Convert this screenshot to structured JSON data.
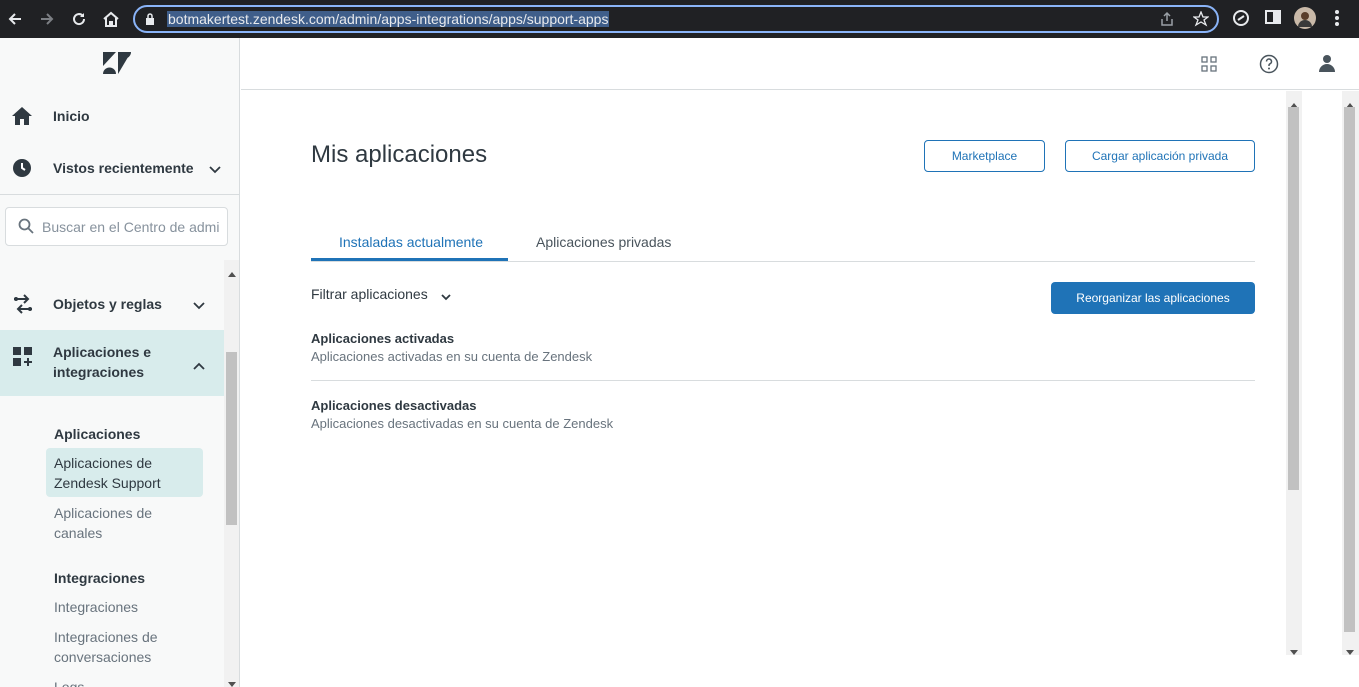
{
  "browser": {
    "url": "botmakertest.zendesk.com/admin/apps-integrations/apps/support-apps"
  },
  "sidebar": {
    "home": "Inicio",
    "recent": "Vistos recientemente",
    "search_placeholder": "Buscar en el Centro de admi",
    "objects": "Objetos y reglas",
    "apps_line1": "Aplicaciones e",
    "apps_line2": "integraciones",
    "apps_heading": "Aplicaciones",
    "support_apps_line1": "Aplicaciones de",
    "support_apps_line2": "Zendesk Support",
    "channel_apps_line1": "Aplicaciones de",
    "channel_apps_line2": "canales",
    "integrations_heading": "Integraciones",
    "integrations": "Integraciones",
    "conv_line1": "Integraciones de",
    "conv_line2": "conversaciones",
    "logs": "Logs"
  },
  "main": {
    "title": "Mis aplicaciones",
    "marketplace_btn": "Marketplace",
    "upload_btn": "Cargar aplicación privada",
    "tabs": [
      {
        "label": "Instaladas actualmente"
      },
      {
        "label": "Aplicaciones privadas"
      }
    ],
    "filter": "Filtrar aplicaciones",
    "reorder_btn": "Reorganizar las aplicaciones",
    "active_title": "Aplicaciones activadas",
    "active_desc": "Aplicaciones activadas en su cuenta de Zendesk",
    "inactive_title": "Aplicaciones desactivadas",
    "inactive_desc": "Aplicaciones desactivadas en su cuenta de Zendesk"
  },
  "colors": {
    "accent": "#1f73b7",
    "selected_bg": "#d8ecec"
  }
}
